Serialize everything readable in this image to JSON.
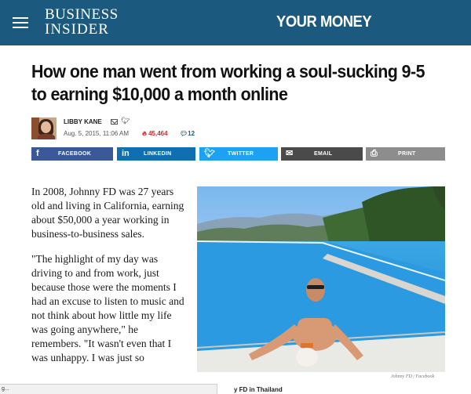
{
  "header": {
    "logo_line1": "BUSINESS",
    "logo_line2": "INSIDER",
    "section": "YOUR MONEY",
    "menu_icon": "hamburger-menu-icon"
  },
  "article": {
    "headline": "How one man went from working a soul-sucking 9-5 to earning $10,000 a month online",
    "author": "LIBBY KANE",
    "date": "Aug. 5, 2015, 11:06 AM",
    "views": "45,464",
    "comments": "12",
    "paragraphs": [
      "In 2008, Johnny FD was 27 years old and living in California, earning about $50,000 a year working in business-to-business sales.",
      "\"The highlight of my day was driving to and from work, just because those were the moments I had an excuse to listen to music and not think about how little my life was going anywhere,\" he remembers. \"It wasn't even that I was unhappy. I was just so"
    ],
    "photo_credit": "Johnny FD / Facebook",
    "caption_fragment": "y FD in Thailand"
  },
  "share": {
    "facebook": "FACEBOOK",
    "linkedin": "LINKEDIN",
    "twitter": "TWITTER",
    "email": "EMAIL",
    "print": "PRINT"
  },
  "icons": {
    "views": "fire-icon",
    "comments": "comment-bubble-icon",
    "mail": "mail-icon",
    "twitter": "twitter-bird-icon"
  },
  "colors": {
    "header_bg": "#1b5a7e",
    "facebook": "#3b5998",
    "linkedin": "#0f6fb0",
    "twitter": "#1da1f2",
    "email": "#4a4a4a",
    "print": "#8d8d8d",
    "views": "#d9272e"
  },
  "statusbar": {
    "text": "g..."
  }
}
